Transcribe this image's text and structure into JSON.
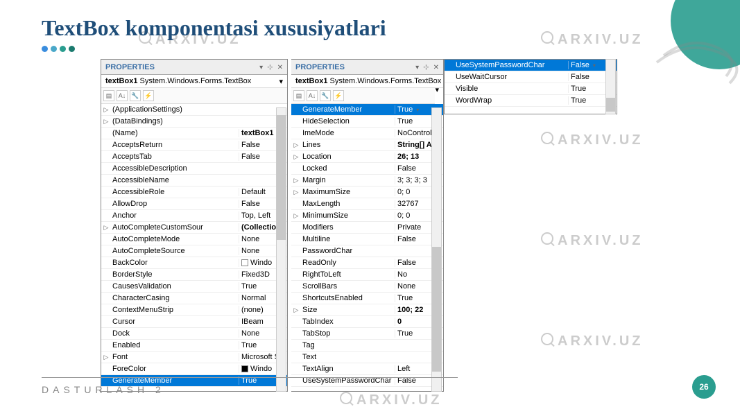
{
  "title": "TextBox komponentasi xususiyatlari",
  "watermark": "ARXIV.UZ",
  "footer": "DASTURLASH 2",
  "page": "26",
  "panels": {
    "header": "PROPERTIES",
    "object_name": "textBox1",
    "object_type": "System.Windows.Forms.TextBox"
  },
  "props1": [
    {
      "name": "(ApplicationSettings)",
      "val": "",
      "exp": "▷"
    },
    {
      "name": "(DataBindings)",
      "val": "",
      "exp": "▷"
    },
    {
      "name": "(Name)",
      "val": "textBox1",
      "bold": true
    },
    {
      "name": "AcceptsReturn",
      "val": "False"
    },
    {
      "name": "AcceptsTab",
      "val": "False"
    },
    {
      "name": "AccessibleDescription",
      "val": ""
    },
    {
      "name": "AccessibleName",
      "val": ""
    },
    {
      "name": "AccessibleRole",
      "val": "Default"
    },
    {
      "name": "AllowDrop",
      "val": "False"
    },
    {
      "name": "Anchor",
      "val": "Top, Left"
    },
    {
      "name": "AutoCompleteCustomSour",
      "val": "(Collection",
      "exp": "▷",
      "bold": true
    },
    {
      "name": "AutoCompleteMode",
      "val": "None"
    },
    {
      "name": "AutoCompleteSource",
      "val": "None"
    },
    {
      "name": "BackColor",
      "val": "Windo",
      "swatch": "#fff"
    },
    {
      "name": "BorderStyle",
      "val": "Fixed3D"
    },
    {
      "name": "CausesValidation",
      "val": "True"
    },
    {
      "name": "CharacterCasing",
      "val": "Normal"
    },
    {
      "name": "ContextMenuStrip",
      "val": "(none)"
    },
    {
      "name": "Cursor",
      "val": "IBeam"
    },
    {
      "name": "Dock",
      "val": "None"
    },
    {
      "name": "Enabled",
      "val": "True"
    },
    {
      "name": "Font",
      "val": "Microsoft S",
      "exp": "▷"
    },
    {
      "name": "ForeColor",
      "val": "Windo",
      "swatch": "#000"
    },
    {
      "name": "GenerateMember",
      "val": "True",
      "sel": true
    }
  ],
  "props2": [
    {
      "name": "GenerateMember",
      "val": "True",
      "sel": true,
      "dd": true
    },
    {
      "name": "HideSelection",
      "val": "True"
    },
    {
      "name": "ImeMode",
      "val": "NoControl"
    },
    {
      "name": "Lines",
      "val": "String[] A",
      "exp": "▷",
      "bold": true
    },
    {
      "name": "Location",
      "val": "26; 13",
      "exp": "▷",
      "bold": true
    },
    {
      "name": "Locked",
      "val": "False"
    },
    {
      "name": "Margin",
      "val": "3; 3; 3; 3",
      "exp": "▷"
    },
    {
      "name": "MaximumSize",
      "val": "0; 0",
      "exp": "▷"
    },
    {
      "name": "MaxLength",
      "val": "32767"
    },
    {
      "name": "MinimumSize",
      "val": "0; 0",
      "exp": "▷"
    },
    {
      "name": "Modifiers",
      "val": "Private"
    },
    {
      "name": "Multiline",
      "val": "False"
    },
    {
      "name": "PasswordChar",
      "val": ""
    },
    {
      "name": "ReadOnly",
      "val": "False"
    },
    {
      "name": "RightToLeft",
      "val": "No"
    },
    {
      "name": "ScrollBars",
      "val": "None"
    },
    {
      "name": "ShortcutsEnabled",
      "val": "True"
    },
    {
      "name": "Size",
      "val": "100; 22",
      "exp": "▷",
      "bold": true
    },
    {
      "name": "TabIndex",
      "val": "0",
      "bold": true
    },
    {
      "name": "TabStop",
      "val": "True"
    },
    {
      "name": "Tag",
      "val": ""
    },
    {
      "name": "Text",
      "val": ""
    },
    {
      "name": "TextAlign",
      "val": "Left"
    },
    {
      "name": "UseSystemPasswordChar",
      "val": "False"
    }
  ],
  "props3": [
    {
      "name": "UseSystemPasswordChar",
      "val": "False",
      "sel": true,
      "dd": true
    },
    {
      "name": "UseWaitCursor",
      "val": "False"
    },
    {
      "name": "Visible",
      "val": "True"
    },
    {
      "name": "WordWrap",
      "val": "True"
    }
  ]
}
